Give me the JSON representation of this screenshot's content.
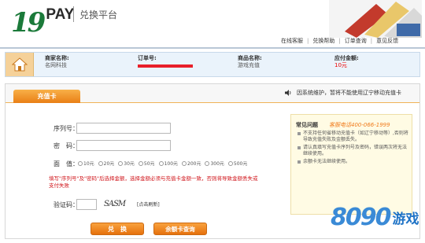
{
  "header": {
    "brand_number": "19",
    "brand_name": "PAY",
    "title": "兑换平台",
    "nav": [
      "在线客服",
      "兑换帮助",
      "订单查询",
      "意见反馈"
    ]
  },
  "order": {
    "merchant_label": "商家名称:",
    "merchant_value": "名网科技",
    "order_label": "订单号:",
    "product_label": "商品名称:",
    "product_value": "游戏充值",
    "amount_label": "应付金额:",
    "amount_value": "10元"
  },
  "tab": {
    "label": "充值卡",
    "notice": "因系统维护，暂将不能使用辽宁移动充值卡"
  },
  "form": {
    "serial_label": "序列号：",
    "password_label": "密　码：",
    "denomination_label": "面　值：",
    "denominations": [
      "10元",
      "20元",
      "30元",
      "50元",
      "100元",
      "200元",
      "300元",
      "500元"
    ],
    "warning": "填写\"序列号\"及\"密码\"后选择金额，选择金额必须与充值卡金额一致，否则将导致金额丢失或支付失败",
    "captcha_label": "验证码：",
    "captcha_text": "SASM",
    "refresh_label": "[点击刷新]",
    "submit_label": "兑　换",
    "query_label": "余额卡查询"
  },
  "help": {
    "title": "常见问题",
    "phone": "客服电话400-066-1999",
    "items": [
      "不支持任何省移动充值卡（如辽宁移动等）,否则将导致充值失败及金额丢失。",
      "请认真填写充值卡序列号及密码，错误两次将无法继续使用。",
      "余额卡无法继续使用。"
    ]
  },
  "watermark": {
    "number": "8090",
    "text": "游戏"
  },
  "colors": {
    "accent_orange": "#e97f16",
    "brand_green": "#1b7a3a",
    "warning_red": "#d0141a"
  }
}
